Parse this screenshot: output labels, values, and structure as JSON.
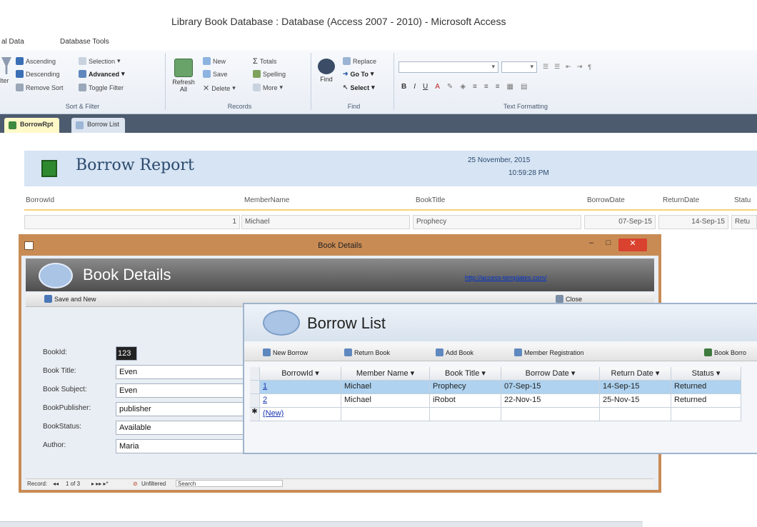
{
  "app": {
    "title": "Library Book Database : Database (Access 2007 - 2010) - Microsoft Access"
  },
  "ribbon": {
    "tabs": [
      "al Data",
      "Database Tools"
    ],
    "sort_filter": {
      "items": [
        "Ascending",
        "Descending",
        "Remove Sort",
        "Selection",
        "Advanced",
        "Toggle Filter"
      ],
      "left_label": "lter",
      "group_label": "Sort & Filter"
    },
    "records": {
      "refresh_label": "Refresh All",
      "items": [
        "New",
        "Save",
        "Delete",
        "Totals",
        "Spelling",
        "More"
      ],
      "group_label": "Records"
    },
    "find": {
      "find_label": "Find",
      "items": [
        "Replace",
        "Go To",
        "Select"
      ],
      "group_label": "Find"
    },
    "text_formatting": {
      "group_label": "Text Formatting"
    }
  },
  "doc_tabs": [
    {
      "label": "BorrowRpt",
      "active": true
    },
    {
      "label": "Borrow List",
      "active": false
    }
  ],
  "report": {
    "title": "Borrow Report",
    "date": "25 November, 2015",
    "time": "10:59:28 PM",
    "columns": [
      "BorrowId",
      "MemberName",
      "BookTitle",
      "BorrowDate",
      "ReturnDate",
      "Statu"
    ],
    "row": {
      "id": "1",
      "member": "Michael",
      "title": "Prophecy",
      "borrow": "07-Sep-15",
      "return": "14-Sep-15",
      "status": "Retu"
    }
  },
  "book_details": {
    "window_title": "Book Details",
    "header_title": "Book Details",
    "link": "http://access-templates.com/",
    "save_new": "Save and New",
    "close": "Close",
    "fields": [
      {
        "label": "BookId:",
        "value": "123"
      },
      {
        "label": "Book Title:",
        "value": "Even"
      },
      {
        "label": "Book Subject:",
        "value": "Even"
      },
      {
        "label": "BookPublisher:",
        "value": "publisher"
      },
      {
        "label": "BookStatus:",
        "value": "Available"
      },
      {
        "label": "Author:",
        "value": "Maria"
      }
    ],
    "nav": {
      "record_label": "Record:",
      "position": "1 of 3",
      "unfiltered": "Unfiltered",
      "search": "Search"
    }
  },
  "borrow_list": {
    "title": "Borrow List",
    "toolbar": [
      "New Borrow",
      "Return Book",
      "Add Book",
      "Member Registration",
      "Book Borro"
    ],
    "columns": [
      "BorrowId",
      "Member Name",
      "Book Title",
      "Borrow Date",
      "Return Date",
      "Status"
    ],
    "rows": [
      {
        "id": "1",
        "member": "Michael",
        "title": "Prophecy",
        "borrow": "07-Sep-15",
        "return": "14-Sep-15",
        "status": "Returned"
      },
      {
        "id": "2",
        "member": "Michael",
        "title": "iRobot",
        "borrow": "22-Nov-15",
        "return": "25-Nov-15",
        "status": "Returned"
      }
    ],
    "new_row": "(New)"
  }
}
